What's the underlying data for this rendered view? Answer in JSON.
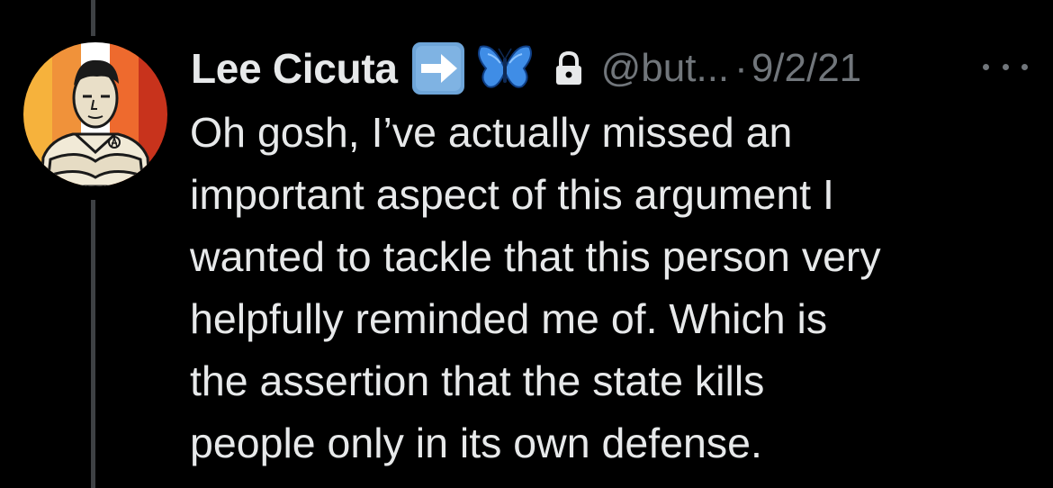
{
  "tweet": {
    "display_name": "Lee Cicuta",
    "handle": "@but...",
    "separator": "·",
    "date": "9/2/21",
    "badges": [
      "arrow-right-emoji",
      "butterfly-emoji",
      "lock-icon"
    ],
    "body_lines": [
      "Oh gosh, I’ve actually missed an",
      "important aspect of this argument I",
      "wanted to tackle that this person very",
      "helpfully reminded me of. Which is",
      "the assertion that the state kills",
      "people only in its own defense."
    ],
    "more_icon": "more-horizontal-icon"
  },
  "colors": {
    "background": "#000000",
    "text_primary": "#e7e9ea",
    "text_secondary": "#71767b",
    "thread_line": "#3e4144",
    "link": "#1d9bf0"
  }
}
